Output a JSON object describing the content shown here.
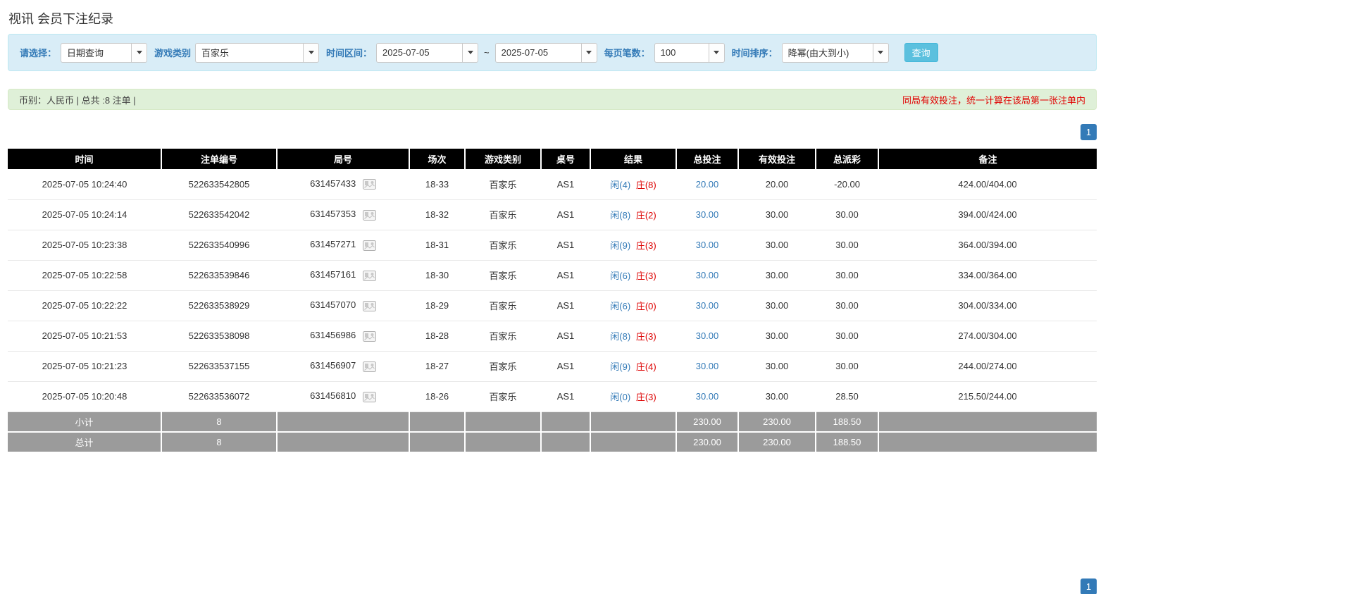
{
  "page": {
    "title": "视讯 会员下注纪录"
  },
  "filters": {
    "query_type_label": "请选择：",
    "query_type_value": "日期查询",
    "game_type_label": "游戏类别",
    "game_type_value": "百家乐",
    "date_range_label": "时间区间：",
    "date_from": "2025-07-05",
    "date_to": "2025-07-05",
    "range_separator": "~",
    "page_size_label": "每页笔数：",
    "page_size_value": "100",
    "sort_label": "时间排序：",
    "sort_value": "降幂(由大到小)",
    "search_button_label": "查询"
  },
  "info_bar": {
    "summary": "币别：人民币 | 总共 :8 注单 |",
    "notice": "同局有效投注，统一计算在该局第一张注单内"
  },
  "pagination": {
    "current_page": "1"
  },
  "table": {
    "headers": [
      "时间",
      "注单编号",
      "局号",
      "场次",
      "游戏类别",
      "桌号",
      "结果",
      "总投注",
      "有效投注",
      "总派彩",
      "备注"
    ],
    "rows": [
      {
        "time": "2025-07-05 10:24:40",
        "bet_id": "522633542805",
        "round_id": "631457433",
        "session": "18-33",
        "game": "百家乐",
        "table_no": "AS1",
        "result_player": "闲(4)",
        "result_banker": "庄(8)",
        "total_bet": "20.00",
        "valid_bet": "20.00",
        "payout": "-20.00",
        "remark": "424.00/404.00"
      },
      {
        "time": "2025-07-05 10:24:14",
        "bet_id": "522633542042",
        "round_id": "631457353",
        "session": "18-32",
        "game": "百家乐",
        "table_no": "AS1",
        "result_player": "闲(8)",
        "result_banker": "庄(2)",
        "total_bet": "30.00",
        "valid_bet": "30.00",
        "payout": "30.00",
        "remark": "394.00/424.00"
      },
      {
        "time": "2025-07-05 10:23:38",
        "bet_id": "522633540996",
        "round_id": "631457271",
        "session": "18-31",
        "game": "百家乐",
        "table_no": "AS1",
        "result_player": "闲(9)",
        "result_banker": "庄(3)",
        "total_bet": "30.00",
        "valid_bet": "30.00",
        "payout": "30.00",
        "remark": "364.00/394.00"
      },
      {
        "time": "2025-07-05 10:22:58",
        "bet_id": "522633539846",
        "round_id": "631457161",
        "session": "18-30",
        "game": "百家乐",
        "table_no": "AS1",
        "result_player": "闲(6)",
        "result_banker": "庄(3)",
        "total_bet": "30.00",
        "valid_bet": "30.00",
        "payout": "30.00",
        "remark": "334.00/364.00"
      },
      {
        "time": "2025-07-05 10:22:22",
        "bet_id": "522633538929",
        "round_id": "631457070",
        "session": "18-29",
        "game": "百家乐",
        "table_no": "AS1",
        "result_player": "闲(6)",
        "result_banker": "庄(0)",
        "total_bet": "30.00",
        "valid_bet": "30.00",
        "payout": "30.00",
        "remark": "304.00/334.00"
      },
      {
        "time": "2025-07-05 10:21:53",
        "bet_id": "522633538098",
        "round_id": "631456986",
        "session": "18-28",
        "game": "百家乐",
        "table_no": "AS1",
        "result_player": "闲(8)",
        "result_banker": "庄(3)",
        "total_bet": "30.00",
        "valid_bet": "30.00",
        "payout": "30.00",
        "remark": "274.00/304.00"
      },
      {
        "time": "2025-07-05 10:21:23",
        "bet_id": "522633537155",
        "round_id": "631456907",
        "session": "18-27",
        "game": "百家乐",
        "table_no": "AS1",
        "result_player": "闲(9)",
        "result_banker": "庄(4)",
        "total_bet": "30.00",
        "valid_bet": "30.00",
        "payout": "30.00",
        "remark": "244.00/274.00"
      },
      {
        "time": "2025-07-05 10:20:48",
        "bet_id": "522633536072",
        "round_id": "631456810",
        "session": "18-26",
        "game": "百家乐",
        "table_no": "AS1",
        "result_player": "闲(0)",
        "result_banker": "庄(3)",
        "total_bet": "30.00",
        "valid_bet": "30.00",
        "payout": "28.50",
        "remark": "215.50/244.00"
      }
    ],
    "summary_rows": [
      {
        "label": "小计",
        "count": "8",
        "total_bet": "230.00",
        "valid_bet": "230.00",
        "payout": "188.50"
      },
      {
        "label": "总计",
        "count": "8",
        "total_bet": "230.00",
        "valid_bet": "230.00",
        "payout": "188.50"
      }
    ]
  },
  "icons": {
    "round_result": "game-result-icon",
    "dropdown": "chevron-down-icon"
  },
  "colors": {
    "filter_bar_bg": "#d9edf7",
    "filter_bar_border": "#bce8f1",
    "filter_label_blue": "#337ab7",
    "info_bar_bg": "#dff0d8",
    "info_bar_border": "#d6e9c6",
    "notice_red": "#e00000",
    "table_header_bg": "#000000",
    "summary_row_bg": "#9b9b9b",
    "link_blue": "#337ab7",
    "player_blue": "#337ab7",
    "banker_red": "#dd0000",
    "negative_red": "#e00000",
    "search_button_bg": "#5bc0de",
    "pagination_bg": "#337ab7"
  }
}
